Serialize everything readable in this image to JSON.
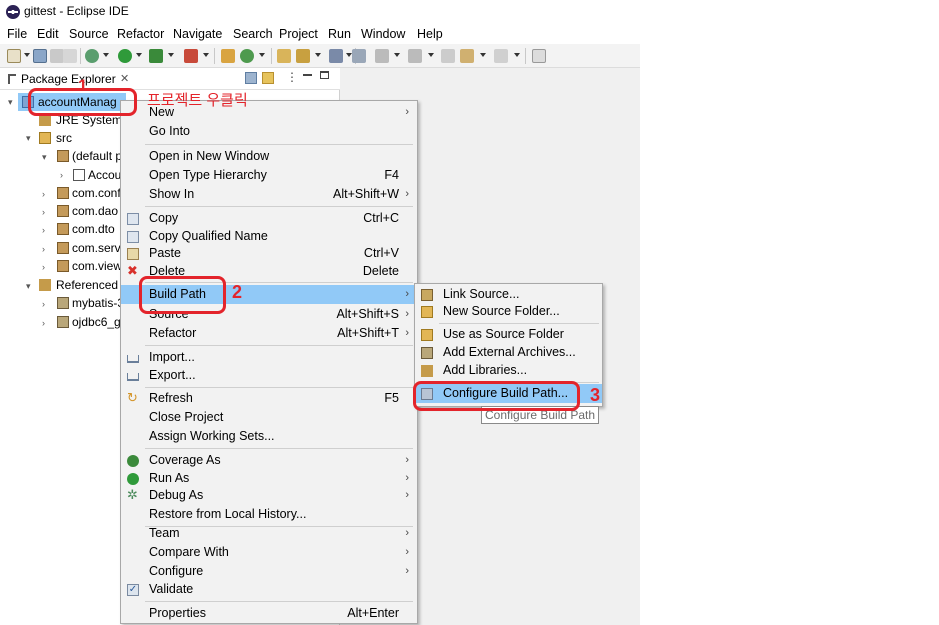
{
  "window": {
    "title": "gittest - Eclipse IDE"
  },
  "menubar": [
    "File",
    "Edit",
    "Source",
    "Refactor",
    "Navigate",
    "Search",
    "Project",
    "Run",
    "Window",
    "Help"
  ],
  "package_explorer": {
    "tab_label": "Package Explorer",
    "tree": [
      {
        "label": "accountManag",
        "icon": "project-icon"
      },
      {
        "label": "JRE System",
        "icon": "library-icon"
      },
      {
        "label": "src",
        "icon": "source-folder-icon"
      },
      {
        "label": "(default p",
        "icon": "package-icon"
      },
      {
        "label": "Accou",
        "icon": "java-file-icon"
      },
      {
        "label": "com.conf",
        "icon": "package-icon"
      },
      {
        "label": "com.dao",
        "icon": "package-icon"
      },
      {
        "label": "com.dto",
        "icon": "package-icon"
      },
      {
        "label": "com.servi",
        "icon": "package-icon"
      },
      {
        "label": "com.view",
        "icon": "package-icon"
      },
      {
        "label": "Referenced",
        "icon": "library-icon"
      },
      {
        "label": "mybatis-3",
        "icon": "jar-icon"
      },
      {
        "label": "ojdbc6_g",
        "icon": "jar-icon"
      }
    ]
  },
  "context_menu": {
    "items": [
      {
        "label": "New",
        "accel": "",
        "submenu": true
      },
      {
        "label": "Go Into",
        "accel": ""
      },
      {
        "label": "Open in New Window",
        "accel": ""
      },
      {
        "label": "Open Type Hierarchy",
        "accel": "F4"
      },
      {
        "label": "Show In",
        "accel": "Alt+Shift+W",
        "submenu": true
      },
      {
        "label": "Copy",
        "accel": "Ctrl+C"
      },
      {
        "label": "Copy Qualified Name",
        "accel": ""
      },
      {
        "label": "Paste",
        "accel": "Ctrl+V"
      },
      {
        "label": "Delete",
        "accel": "Delete"
      },
      {
        "label": "Build Path",
        "accel": "",
        "submenu": true,
        "highlighted": true
      },
      {
        "label": "Source",
        "accel": "Alt+Shift+S",
        "submenu": true
      },
      {
        "label": "Refactor",
        "accel": "Alt+Shift+T",
        "submenu": true
      },
      {
        "label": "Import...",
        "accel": ""
      },
      {
        "label": "Export...",
        "accel": ""
      },
      {
        "label": "Refresh",
        "accel": "F5"
      },
      {
        "label": "Close Project",
        "accel": ""
      },
      {
        "label": "Assign Working Sets...",
        "accel": ""
      },
      {
        "label": "Coverage As",
        "accel": "",
        "submenu": true
      },
      {
        "label": "Run As",
        "accel": "",
        "submenu": true
      },
      {
        "label": "Debug As",
        "accel": "",
        "submenu": true
      },
      {
        "label": "Restore from Local History...",
        "accel": ""
      },
      {
        "label": "Team",
        "accel": "",
        "submenu": true
      },
      {
        "label": "Compare With",
        "accel": "",
        "submenu": true
      },
      {
        "label": "Configure",
        "accel": "",
        "submenu": true
      },
      {
        "label": "Validate",
        "accel": ""
      },
      {
        "label": "Properties",
        "accel": "Alt+Enter"
      }
    ]
  },
  "build_path_submenu": {
    "items": [
      {
        "label": "Link Source..."
      },
      {
        "label": "New Source Folder..."
      },
      {
        "label": "Use as Source Folder"
      },
      {
        "label": "Add External Archives..."
      },
      {
        "label": "Add Libraries..."
      },
      {
        "label": "Configure Build Path...",
        "highlighted": true
      }
    ],
    "tooltip": "Configure Build Path"
  },
  "annotations": {
    "step1": "1",
    "step1_note": "프로젝트 우클릭",
    "step2": "2",
    "step3": "3"
  },
  "colors": {
    "highlight": "#91c9f7",
    "annotation_red": "#e3242b"
  }
}
